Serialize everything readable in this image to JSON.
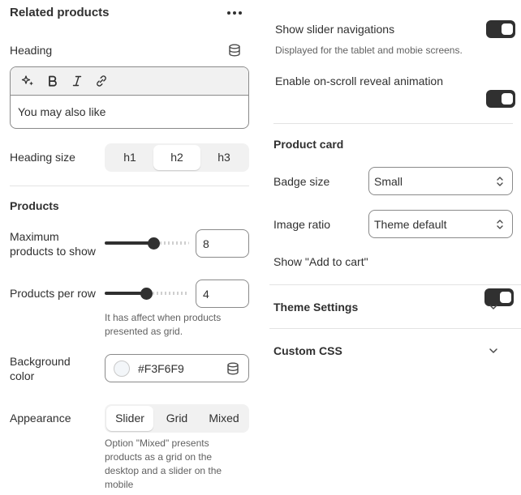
{
  "related": {
    "title": "Related products",
    "heading_label": "Heading",
    "heading_value": "You may also like",
    "heading_size_label": "Heading size",
    "heading_sizes": [
      "h1",
      "h2",
      "h3"
    ],
    "heading_size_selected": "h2"
  },
  "products": {
    "title": "Products",
    "max_label": "Maximum products to show",
    "max_value": "8",
    "max_fraction": 0.58,
    "per_row_label": "Products per row",
    "per_row_value": "4",
    "per_row_fraction": 0.49,
    "per_row_help": "It has affect when products presented as grid.",
    "bg_label": "Background color",
    "bg_value": "#F3F6F9",
    "bg_swatch": "#F3F6F9",
    "appearance_label": "Appearance",
    "appearance_options": [
      "Slider",
      "Grid",
      "Mixed"
    ],
    "appearance_selected": "Slider",
    "appearance_help": "Option \"Mixed\" presents products as a grid on the desktop and a slider on the mobile"
  },
  "slider": {
    "nav_label": "Show slider navigations",
    "nav_help": "Displayed for the tablet and mobie screens.",
    "nav_on": true,
    "reveal_label": "Enable on-scroll reveal animation",
    "reveal_on": true
  },
  "product_card": {
    "title": "Product card",
    "badge_label": "Badge size",
    "badge_value": "Small",
    "ratio_label": "Image ratio",
    "ratio_value": "Theme default",
    "add_to_cart_label": "Show \"Add to cart\"",
    "add_to_cart_on": true
  },
  "sections": {
    "theme_settings": "Theme Settings",
    "custom_css": "Custom CSS"
  },
  "colors": {
    "toggle_on": "#303030",
    "text": "#303030",
    "muted": "#616161"
  }
}
